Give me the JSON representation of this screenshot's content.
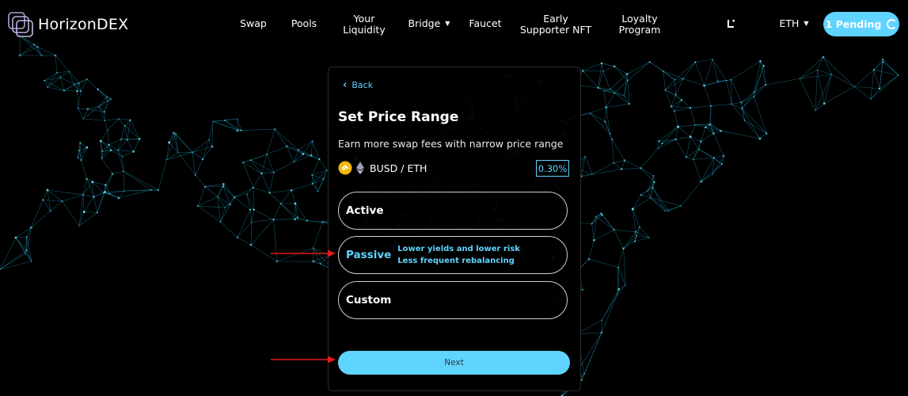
{
  "app": {
    "name": "HorizonDEX"
  },
  "nav": {
    "swap": "Swap",
    "pools": "Pools",
    "liquidity_line1": "Your",
    "liquidity_line2": "Liquidity",
    "bridge": "Bridge",
    "faucet": "Faucet",
    "nft_line1": "Early",
    "nft_line2": "Supporter NFT",
    "loyalty_line1": "Loyalty",
    "loyalty_line2": "Program",
    "network": "ETH",
    "pending": "1 Pending"
  },
  "card": {
    "back": "Back",
    "title": "Set Price Range",
    "subtitle": "Earn more swap fees with narrow price range",
    "pair": "BUSD / ETH",
    "fee": "0.30%",
    "options": [
      {
        "label": "Active"
      },
      {
        "label": "Passive",
        "desc1": "Lower yields and lower risk",
        "desc2": "Less frequent rebalancing"
      },
      {
        "label": "Custom"
      }
    ],
    "next": "Next"
  },
  "colors": {
    "accent": "#5fd4ff",
    "background": "#000000",
    "annotation_arrow": "#e01b1b"
  }
}
